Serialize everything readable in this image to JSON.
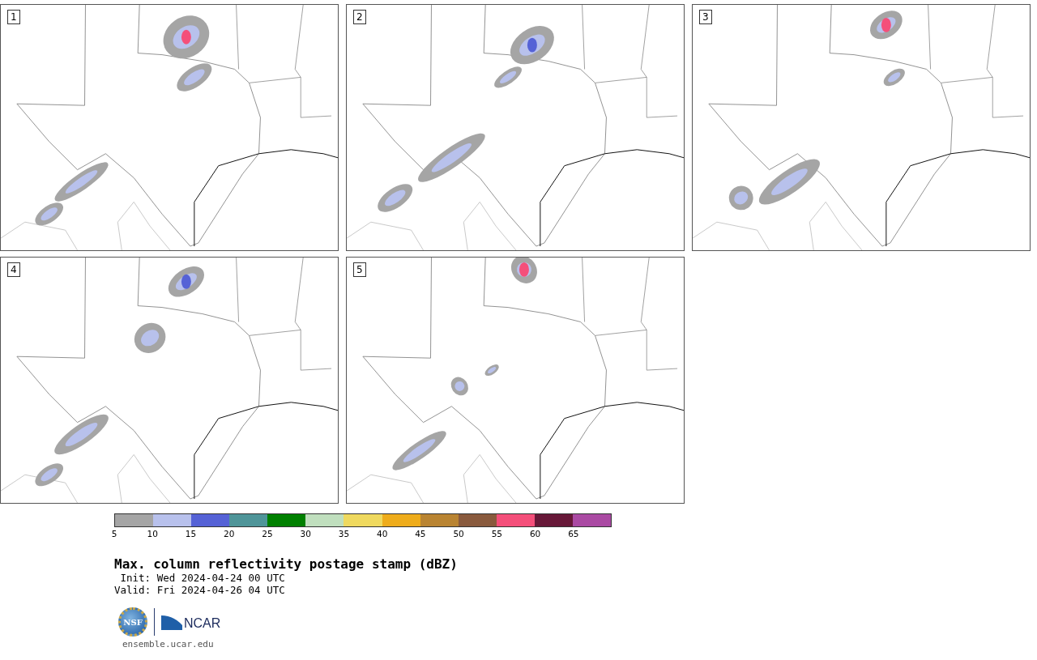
{
  "panels": [
    {
      "label": "1"
    },
    {
      "label": "2"
    },
    {
      "label": "3"
    },
    {
      "label": "4"
    },
    {
      "label": "5"
    }
  ],
  "colorbar": {
    "segments": [
      {
        "color": "#a5a5a5",
        "label": "5"
      },
      {
        "color": "#b8c1ec",
        "label": "10"
      },
      {
        "color": "#5562d6",
        "label": "15"
      },
      {
        "color": "#4f9599",
        "label": "20"
      },
      {
        "color": "#008000",
        "label": "25"
      },
      {
        "color": "#c0dfbe",
        "label": "30"
      },
      {
        "color": "#efd95f",
        "label": "35"
      },
      {
        "color": "#eeac1b",
        "label": "40"
      },
      {
        "color": "#b98432",
        "label": "45"
      },
      {
        "color": "#895a3d",
        "label": "50"
      },
      {
        "color": "#f44f7a",
        "label": "55"
      },
      {
        "color": "#671838",
        "label": "60"
      },
      {
        "color": "#aa4aa3",
        "label": "65"
      }
    ]
  },
  "title": "Max. column reflectivity postage stamp (dBZ)",
  "init": "Init: Wed 2024-04-24 00 UTC",
  "valid": "Valid: Fri 2024-04-26 04 UTC",
  "logos": {
    "nsf": "NSF",
    "ncar": "NCAR"
  },
  "site": "ensemble.ucar.edu"
}
